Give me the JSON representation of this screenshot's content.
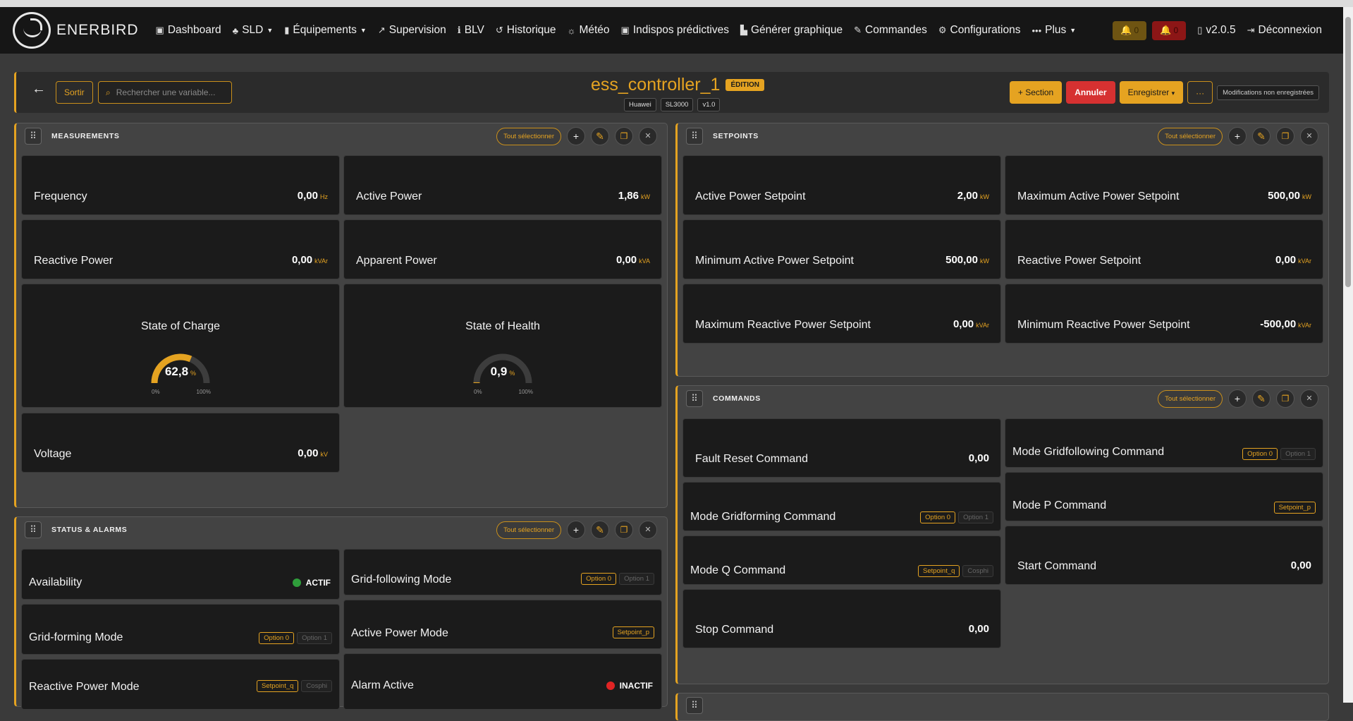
{
  "nav": {
    "brand": "ENERBIRD",
    "items": [
      {
        "icon": "▣",
        "label": "Dashboard",
        "caret": false
      },
      {
        "icon": "♣",
        "label": "SLD",
        "caret": true
      },
      {
        "icon": "▮",
        "label": "Équipements",
        "caret": true
      },
      {
        "icon": "↗",
        "label": "Supervision",
        "caret": false
      },
      {
        "icon": "ℹ",
        "label": "BLV",
        "caret": false
      },
      {
        "icon": "↺",
        "label": "Historique",
        "caret": false
      },
      {
        "icon": "☼",
        "label": "Météo",
        "caret": false
      },
      {
        "icon": "▣",
        "label": "Indispos prédictives",
        "caret": false
      },
      {
        "icon": "▙",
        "label": "Générer graphique",
        "caret": false
      },
      {
        "icon": "✎",
        "label": "Commandes",
        "caret": false
      },
      {
        "icon": "⚙",
        "label": "Configurations",
        "caret": false
      },
      {
        "icon": "•••",
        "label": "Plus",
        "caret": true
      }
    ],
    "warn_count": "0",
    "alarm_count": "0",
    "version": "v2.0.5",
    "logout": "Déconnexion"
  },
  "editor": {
    "back": "←",
    "exit_label": "Sortir",
    "search_placeholder": "Rechercher une variable...",
    "title": "ess_controller_1",
    "mode_badge": "ÉDITION",
    "tags": [
      "Huawei",
      "SL3000",
      "v1.0"
    ],
    "add_section": "+ Section",
    "cancel": "Annuler",
    "save": "Enregistrer",
    "more": "···",
    "unsaved": "Modifications non enregistrées"
  },
  "colors": {
    "accent": "#e5a321",
    "danger": "#d63131",
    "ok": "#2f9e3b",
    "alarm": "#e02424"
  },
  "sections": {
    "select_all": "Tout sélectionner",
    "measurements": {
      "title": "MEASUREMENTS",
      "cards": [
        {
          "label": "Frequency",
          "value": "0,00",
          "unit": "Hz"
        },
        {
          "label": "Active Power",
          "value": "1,86",
          "unit": "kW"
        },
        {
          "label": "Reactive Power",
          "value": "0,00",
          "unit": "kVAr"
        },
        {
          "label": "Apparent Power",
          "value": "0,00",
          "unit": "kVA"
        },
        {
          "label": "Voltage",
          "value": "0,00",
          "unit": "kV"
        }
      ],
      "gauges": [
        {
          "label": "State of Charge",
          "value": "62,8",
          "unit": "%",
          "fraction": 0.628,
          "min": "0%",
          "max": "100%"
        },
        {
          "label": "State of Health",
          "value": "0,9",
          "unit": "%",
          "fraction": 0.009,
          "min": "0%",
          "max": "100%"
        }
      ]
    },
    "setpoints": {
      "title": "SETPOINTS",
      "cards": [
        {
          "label": "Active Power Setpoint",
          "value": "2,00",
          "unit": "kW"
        },
        {
          "label": "Maximum Active Power Setpoint",
          "value": "500,00",
          "unit": "kW"
        },
        {
          "label": "Minimum Active Power Setpoint",
          "value": "500,00",
          "unit": "kW"
        },
        {
          "label": "Reactive Power Setpoint",
          "value": "0,00",
          "unit": "kVAr"
        },
        {
          "label": "Maximum Reactive Power Setpoint",
          "value": "0,00",
          "unit": "kVAr"
        },
        {
          "label": "Minimum Reactive Power Setpoint",
          "value": "-500,00",
          "unit": "kVAr"
        }
      ]
    },
    "status": {
      "title": "STATUS & ALARMS",
      "availability": {
        "label": "Availability",
        "status": "ACTIF"
      },
      "grid_following": {
        "label": "Grid-following Mode",
        "opt_on": "Option 0",
        "opt_off": "Option 1"
      },
      "grid_forming": {
        "label": "Grid-forming Mode",
        "opt_on": "Option 0",
        "opt_off": "Option 1"
      },
      "active_power_mode": {
        "label": "Active Power Mode",
        "opt_on": "Setpoint_p"
      },
      "reactive_power_mode": {
        "label": "Reactive Power Mode",
        "opt_on": "Setpoint_q",
        "opt_off": "Cosphi"
      },
      "alarm_active": {
        "label": "Alarm Active",
        "status": "INACTIF"
      }
    },
    "commands": {
      "title": "COMMANDS",
      "fault_reset": {
        "label": "Fault Reset Command",
        "value": "0,00"
      },
      "mode_gridfollowing": {
        "label": "Mode Gridfollowing Command",
        "opt_on": "Option 0",
        "opt_off": "Option 1"
      },
      "mode_gridforming": {
        "label": "Mode Gridforming Command",
        "opt_on": "Option 0",
        "opt_off": "Option 1"
      },
      "mode_p": {
        "label": "Mode P Command",
        "opt_on": "Setpoint_p"
      },
      "mode_q": {
        "label": "Mode Q Command",
        "opt_on": "Setpoint_q",
        "opt_off": "Cosphi"
      },
      "start": {
        "label": "Start Command",
        "value": "0,00"
      },
      "stop": {
        "label": "Stop Command",
        "value": "0,00"
      }
    }
  }
}
